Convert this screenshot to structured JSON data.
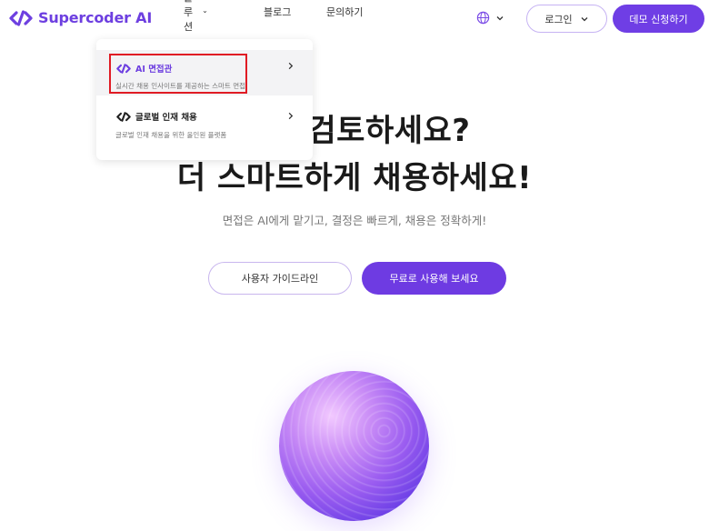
{
  "brand": {
    "name": "Supercoder AI",
    "color": "#6d3fe0"
  },
  "nav": {
    "solutions": "솔루션",
    "blog": "블로그",
    "contact": "문의하기"
  },
  "header": {
    "globe_icon": "globe-icon",
    "login": "로그인",
    "demo": "데모 신청하기"
  },
  "dropdown": {
    "items": [
      {
        "title": "AI 면접관",
        "desc": "실시간 채용 인사이트를 제공하는 스마트 면접"
      },
      {
        "title": "글로벌 인재 채용",
        "desc": "글로벌 인재 채용을 위한 올인원 플랫폼"
      }
    ]
  },
  "hero": {
    "line1": "력서 검토하세요?",
    "line2": "더 스마트하게 채용하세요!",
    "subtitle": "면접은 AI에게 맡기고, 결정은 빠르게, 채용은 정확하게!"
  },
  "cta": {
    "guide": "사용자 가이드라인",
    "free": "무료로 사용해 보세요"
  }
}
